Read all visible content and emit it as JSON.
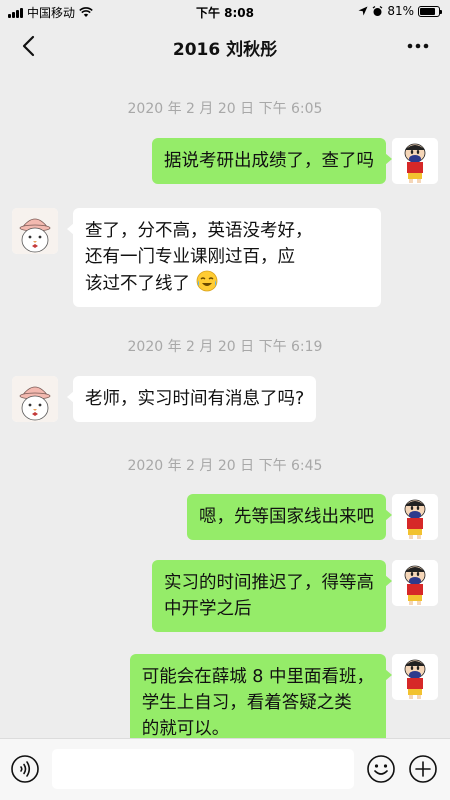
{
  "status_bar": {
    "carrier": "中国移动",
    "time": "下午 8:08",
    "battery_percent": "81%",
    "battery_level": 0.81
  },
  "nav": {
    "title": "2016 刘秋彤",
    "back_icon": "chevron-left-icon",
    "more_icon": "more-dots-icon"
  },
  "messages": {
    "ts1": "2020 年 2 月 20 日 下午 6:05",
    "m1": "据说考研出成绩了，查了吗",
    "m2_line1": "查了，分不高，英语没考好，",
    "m2_line2": "还有一门专业课刚过百，应",
    "m2_line3": "该过不了线了",
    "m2_emoji": "crying-laughing-emoji",
    "ts2": "2020 年 2 月 20 日 下午 6:19",
    "m3": "老师，实习时间有消息了吗?",
    "ts3": "2020 年 2 月 20 日 下午 6:45",
    "m4": "嗯，先等国家线出来吧",
    "m5_line1": "实习的时间推迟了，得等高",
    "m5_line2": "中开学之后",
    "m6_line1": "可能会在薛城 8 中里面看班，",
    "m6_line2": "学生上自习，看着答疑之类",
    "m6_line3": "的就可以。"
  },
  "input_bar": {
    "voice_icon": "voice-icon",
    "emoji_icon": "emoji-icon",
    "plus_icon": "plus-icon"
  },
  "colors": {
    "background": "#ededed",
    "outgoing_bubble": "#95ec69",
    "incoming_bubble": "#ffffff",
    "timestamp": "#a8a8a8"
  }
}
